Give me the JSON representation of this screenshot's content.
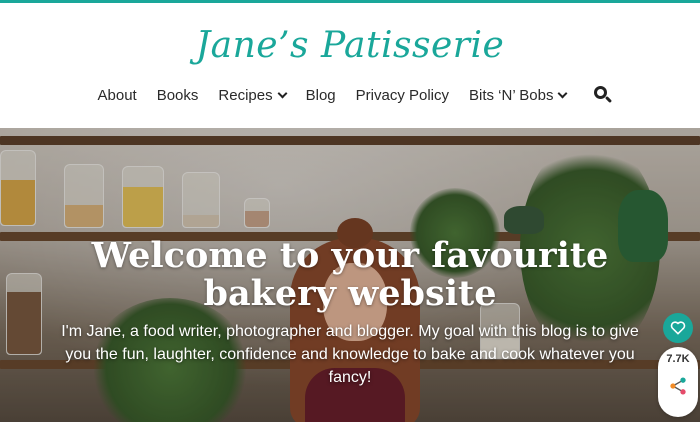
{
  "brand": {
    "name": "Jane’s Patisserie",
    "accent": "#1aa79a"
  },
  "nav": {
    "items": [
      {
        "label": "About",
        "has_dropdown": false
      },
      {
        "label": "Books",
        "has_dropdown": false
      },
      {
        "label": "Recipes",
        "has_dropdown": true
      },
      {
        "label": "Blog",
        "has_dropdown": false
      },
      {
        "label": "Privacy Policy",
        "has_dropdown": false
      },
      {
        "label": "Bits ‘N’ Bobs",
        "has_dropdown": true
      }
    ],
    "search_icon": "search-icon"
  },
  "hero": {
    "title_line1": "Welcome to your favourite",
    "title_line2": "bakery website",
    "text": "I'm Jane, a food writer, photographer and blogger. My goal with this blog is to give you the fun, laughter, confidence and knowledge to bake and cook whatever you fancy!"
  },
  "share": {
    "count": "7.7K",
    "heart_icon": "heart-icon",
    "share_icon": "share-icon"
  }
}
